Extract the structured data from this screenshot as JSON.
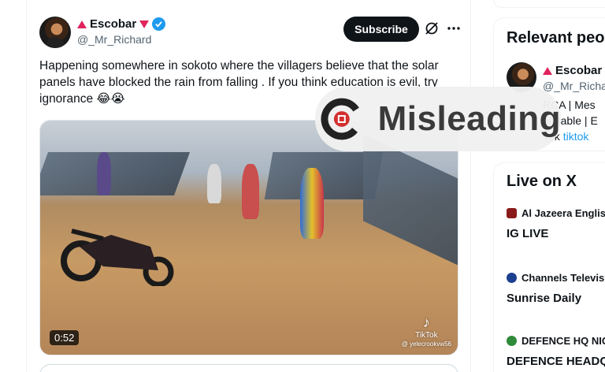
{
  "tweet": {
    "author_name": "Escobar",
    "handle": "@_Mr_Richard",
    "subscribe_label": "Subscribe",
    "text": "Happening somewhere in sokoto where the villagers believe that the solar panels have blocked the rain from falling . If you think education is evil, try ignorance 😂😭",
    "video": {
      "duration": "0:52",
      "watermark_brand": "TikTok",
      "watermark_handle": "@ yelecrookvw56"
    }
  },
  "sidebar": {
    "relevant_title": "Relevant peop",
    "relevant": {
      "name": "Escobar",
      "handle": "@_Mr_Richar",
      "bio_line1": "RCA | Mes",
      "bio_line2": "elatable | E",
      "bio_line3_text": "Tok ",
      "bio_line3_link": "tiktok"
    },
    "live_title": "Live on X",
    "live": [
      {
        "source": "Al Jazeera English",
        "title": "IG LIVE",
        "icon_color": "#8a1a1a"
      },
      {
        "source": "Channels Televisi",
        "title": "Sunrise Daily",
        "icon_color": "#1d3f8f"
      },
      {
        "source": "DEFENCE HQ NIGE",
        "title": "DEFENCE HEADQU",
        "icon_color": "#2e8b3a"
      }
    ]
  },
  "badge": {
    "label": "Misleading",
    "accent": "#d32f2f"
  }
}
